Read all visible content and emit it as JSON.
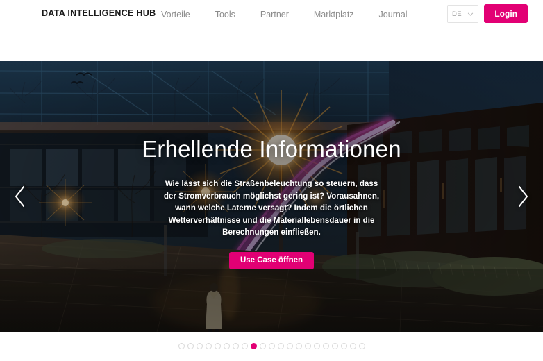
{
  "header": {
    "brand": "DATA INTELLIGENCE HUB",
    "nav": [
      {
        "label": "Vorteile"
      },
      {
        "label": "Tools"
      },
      {
        "label": "Partner"
      },
      {
        "label": "Marktplatz"
      },
      {
        "label": "Journal"
      }
    ],
    "language": {
      "selected": "DE",
      "icon": "chevron-down-icon"
    },
    "login_label": "Login",
    "accent_color": "#e20074"
  },
  "hero": {
    "title": "Erhellende Informationen",
    "body": "Wie lässt sich die Straßenbeleuchtung so steuern, dass der Stromverbrauch möglichst gering ist? Vorausahnen, wann welche Laterne versagt? Indem die örtlichen Wetterverhältnisse und die Materiallebensdauer in die Berechnungen einfließen.",
    "cta_label": "Use Case öffnen",
    "prev_icon": "chevron-left-icon",
    "next_icon": "chevron-right-icon",
    "scene_description": "Dämmerung vor einem Bürogebäude mit Glasfassade, Straßenlaterne mit Lichtstrahlen und magentafarbenem Lichtband, Person auf dem Gehweg"
  },
  "carousel": {
    "total_slides": 21,
    "active_index": 8,
    "active_color": "#e20074",
    "inactive_color": "#d8d8d8"
  }
}
